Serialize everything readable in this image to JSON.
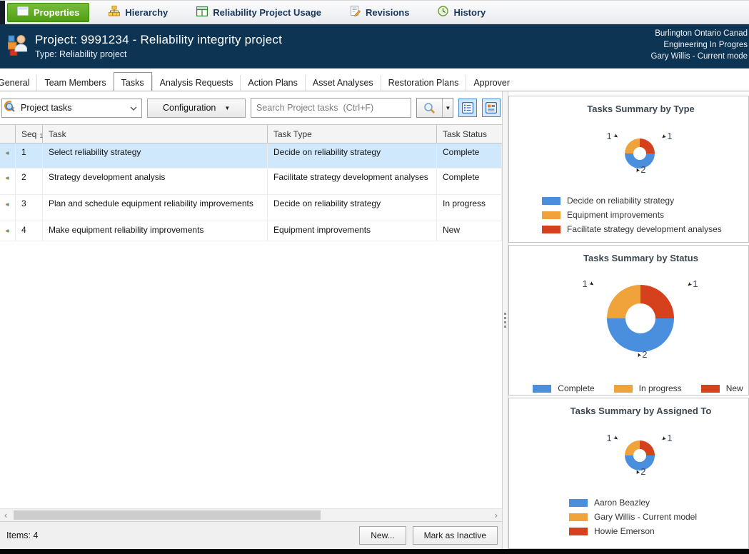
{
  "toolbar": {
    "properties": "Properties",
    "hierarchy": "Hierarchy",
    "usage": "Reliability Project Usage",
    "revisions": "Revisions",
    "history": "History"
  },
  "header": {
    "title": "Project: 9991234 - Reliability integrity project",
    "subtitle": "Type: Reliability  project",
    "line1": "Burlington Ontario Canad",
    "line2": "Engineering In Progres",
    "line3": "Gary Willis - Current mode"
  },
  "tabs": [
    "General",
    "Team Members",
    "Tasks",
    "Analysis Requests",
    "Action Plans",
    "Asset Analyses",
    "Restoration Plans",
    "Approver"
  ],
  "active_tab": "Tasks",
  "filter": {
    "lookup_value": "Project tasks",
    "configuration": "Configuration",
    "search_placeholder": "Search Project tasks  (Ctrl+F)"
  },
  "grid": {
    "columns": {
      "seq": "Seq",
      "task": "Task",
      "type": "Task Type",
      "status": "Task Status"
    },
    "sort_order": "1",
    "rows": [
      {
        "seq": "1",
        "task": "Select reliability strategy",
        "type": "Decide on reliability  strategy",
        "status": "Complete"
      },
      {
        "seq": "2",
        "task": "Strategy development analysis",
        "type": "Facilitate strategy development analyses",
        "status": "Complete"
      },
      {
        "seq": "3",
        "task": "Plan and schedule equipment reliability improvements",
        "type": "Decide on reliability  strategy",
        "status": "In progress"
      },
      {
        "seq": "4",
        "task": "Make equipment reliability improvements",
        "type": "Equipment improvements",
        "status": "New"
      }
    ]
  },
  "statusbar": {
    "items": "Items: 4",
    "new_button": "New...",
    "mark_inactive_button": "Mark as Inactive"
  },
  "chart_data": [
    {
      "type": "donut",
      "title": "Tasks Summary by Type",
      "categories": [
        "Decide on reliability strategy",
        "Equipment improvements",
        "Facilitate strategy development analyses"
      ],
      "values": [
        2,
        1,
        1
      ],
      "colors": [
        "#4a8ede",
        "#f0a33a",
        "#d5411d"
      ],
      "callouts": {
        "left": "1",
        "right": "1",
        "bottom": "2"
      },
      "legend_position": "bottom-left"
    },
    {
      "type": "donut",
      "title": "Tasks Summary by Status",
      "categories": [
        "Complete",
        "In progress",
        "New"
      ],
      "values": [
        2,
        1,
        1
      ],
      "colors": [
        "#4a8ede",
        "#f0a33a",
        "#d5411d"
      ],
      "callouts": {
        "left": "1",
        "right": "1",
        "bottom": "2"
      },
      "legend_position": "bottom-horizontal"
    },
    {
      "type": "donut",
      "title": "Tasks Summary by Assigned To",
      "categories": [
        "Aaron Beazley",
        "Gary Willis - Current model",
        "Howie Emerson"
      ],
      "values": [
        2,
        1,
        1
      ],
      "colors": [
        "#4a8ede",
        "#f0a33a",
        "#d5411d"
      ],
      "callouts": {
        "left": "1",
        "right": "1",
        "bottom": "2"
      },
      "legend_position": "bottom-left"
    }
  ],
  "colors": {
    "accent_green": "#58a618",
    "header_navy": "#0e3453",
    "selection_blue": "#cfe8fb",
    "donut_blue": "#4a8ede",
    "donut_orange": "#f0a33a",
    "donut_red": "#d5411d"
  }
}
